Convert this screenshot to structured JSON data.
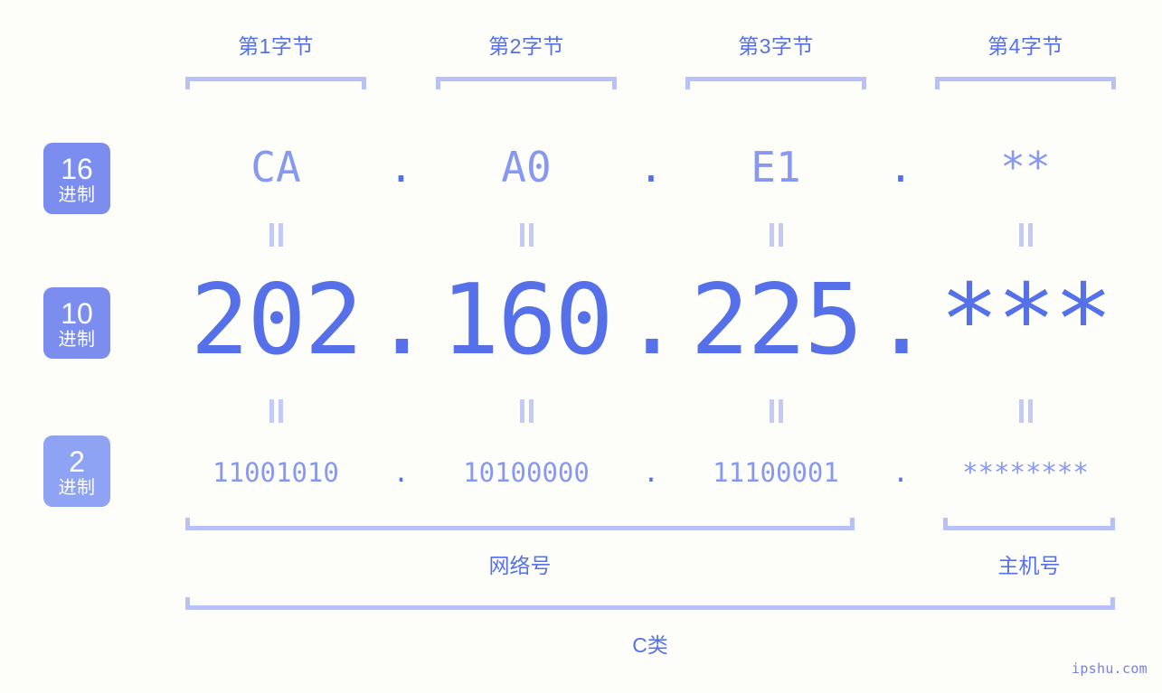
{
  "meta": {
    "watermark": "ipshu.com",
    "colors": {
      "background": "#fdfefa",
      "accent_strong": "#5570e8",
      "accent_mid": "#8798f2",
      "accent_light": "#b7c0f7",
      "badge_bg": "#7b8ef0",
      "badge_text": "#ffffff"
    }
  },
  "byte_headers": [
    {
      "label": "第1字节"
    },
    {
      "label": "第2字节"
    },
    {
      "label": "第3字节"
    },
    {
      "label": "第4字节"
    }
  ],
  "bases": [
    {
      "number": "16",
      "word": "进制"
    },
    {
      "number": "10",
      "word": "进制"
    },
    {
      "number": "2",
      "word": "进制"
    }
  ],
  "separator": ".",
  "rows": {
    "hex": {
      "base": "16",
      "values": [
        "CA",
        "A0",
        "E1",
        "**"
      ]
    },
    "decimal": {
      "base": "10",
      "values": [
        "202",
        "160",
        "225",
        "***"
      ]
    },
    "binary": {
      "base": "2",
      "values": [
        "11001010",
        "10100000",
        "11100001",
        "********"
      ]
    }
  },
  "segments": [
    {
      "label": "网络号"
    },
    {
      "label": "主机号"
    }
  ],
  "class_label": "C类"
}
